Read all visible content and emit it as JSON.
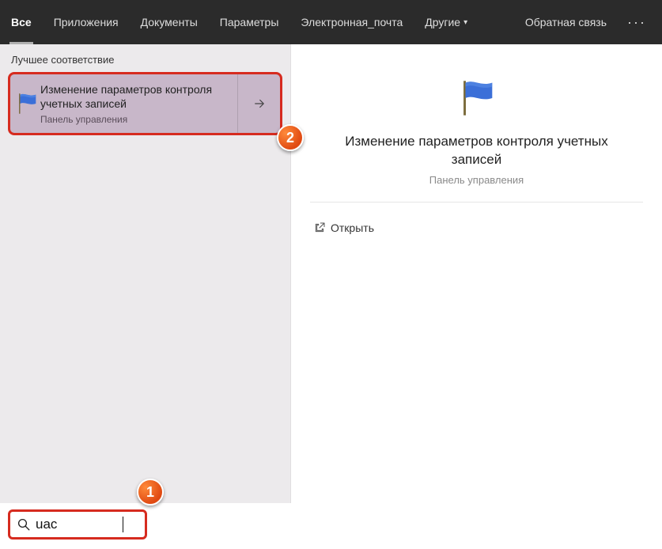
{
  "topbar": {
    "tabs": [
      {
        "label": "Все",
        "active": true
      },
      {
        "label": "Приложения"
      },
      {
        "label": "Документы"
      },
      {
        "label": "Параметры"
      },
      {
        "label": "Электронная_почта"
      },
      {
        "label": "Другие",
        "dropdown": true
      }
    ],
    "feedback": "Обратная связь",
    "more": "···"
  },
  "left": {
    "best_match_header": "Лучшее соответствие",
    "result": {
      "title": "Изменение параметров контроля учетных записей",
      "subtitle": "Панель управления",
      "icon": "flag-icon"
    }
  },
  "preview": {
    "title": "Изменение параметров контроля учетных записей",
    "subtitle": "Панель управления",
    "actions": [
      {
        "icon": "open-icon",
        "label": "Открыть"
      }
    ]
  },
  "search": {
    "value": "uac",
    "placeholder": ""
  },
  "annotations": {
    "badge1": "1",
    "badge2": "2"
  }
}
